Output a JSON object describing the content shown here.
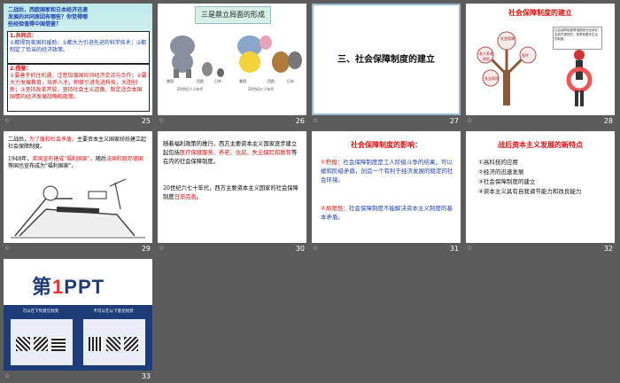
{
  "slides": [
    {
      "num": "25",
      "q": "二战后，西欧国家和日本经济迅速发展的共同原因有哪些？你觉得哪些经验值得中国借鉴？",
      "h1": "1.共同点：",
      "p1": "①都得到美国的援助；②都大力引进先进的科学技术；③都制定了恰当的经济政策。",
      "h2": "2.借鉴：",
      "p2": "①要善于抓住机遇，注意加强国际间经济交流与合作；②要大力发展教育，培养人才，积极引进先进科技，大胆创新；③坚持改革开放，坚持社会主义道路，制定适合本国国情的经济发展战略和政策。"
    },
    {
      "num": "26",
      "title": "三是鼎立局面的形成",
      "cap1": "美国",
      "cap2": "西欧",
      "cap3": "日本",
      "cap4": "20世纪六十年代",
      "cap5": "美国",
      "cap6": "西欧",
      "cap7": "日本",
      "cap8": "20世纪七十年代"
    },
    {
      "num": "27",
      "title": "三、社会保障制度的建立"
    },
    {
      "num": "28",
      "title": "社会保障制度的建立",
      "tree_label": "社会保障",
      "b1": "老人养老保险",
      "b2": "医疗",
      "b3": "失业保险",
      "card": "社会保障制度是指国家对全体社会成员提供的，保障其基本生活的制度。"
    },
    {
      "num": "29",
      "p1a": "二战后，",
      "p1b": "为了缓和社会矛盾，",
      "p1c": "主要资本主义国家纷纷建立起社会保障制度。",
      "p2a": "1948年，",
      "p2b": "英国宣布建成\"福利国家\"。",
      "p2c": "随后",
      "p2d": "法国和联邦德国",
      "p2e": "等国也宣布成为\"福利国家\"。"
    },
    {
      "num": "30",
      "p1a": "随着福利政策的推行，西方主要资本主义国家逐步建立起包括",
      "p1b": "医疗保健服务、养老、住房、失业保险和教育",
      "p1c": "等在内的社会保障制度。",
      "p2a": "20世纪六七十年代，西方主要资本主义国家的社会保障制度",
      "p2b": "日渐完善",
      "p2c": "。"
    },
    {
      "num": "31",
      "title": "社会保障制度的影响：",
      "a1": "①积极：",
      "a2": "社会保障制度是工人阶级斗争的结果，可以缓和阶级矛盾，创造一个有利于经济发展的稳定的社会环境。",
      "b1": "②局限性：",
      "b2": "社会保障制度不能解决资本主义制度的基本矛盾。"
    },
    {
      "num": "32",
      "title": "战后资本主义发展的新特点",
      "items": [
        "①高科技的应用",
        "②经济的迅速发展",
        "③社会保障制度的建立",
        "④资本主义具有自我调节能力和改良能力"
      ]
    },
    {
      "num": "33",
      "brand_a": "第",
      "brand_b": "1",
      "brand_c": "PPT",
      "qr1": "可以在下列意见找到",
      "qr2": "不可以在以下意见找到"
    }
  ],
  "colors": {
    "accent_red": "#d11",
    "navy": "#1e3c78",
    "teal": "#bfe9ea"
  }
}
